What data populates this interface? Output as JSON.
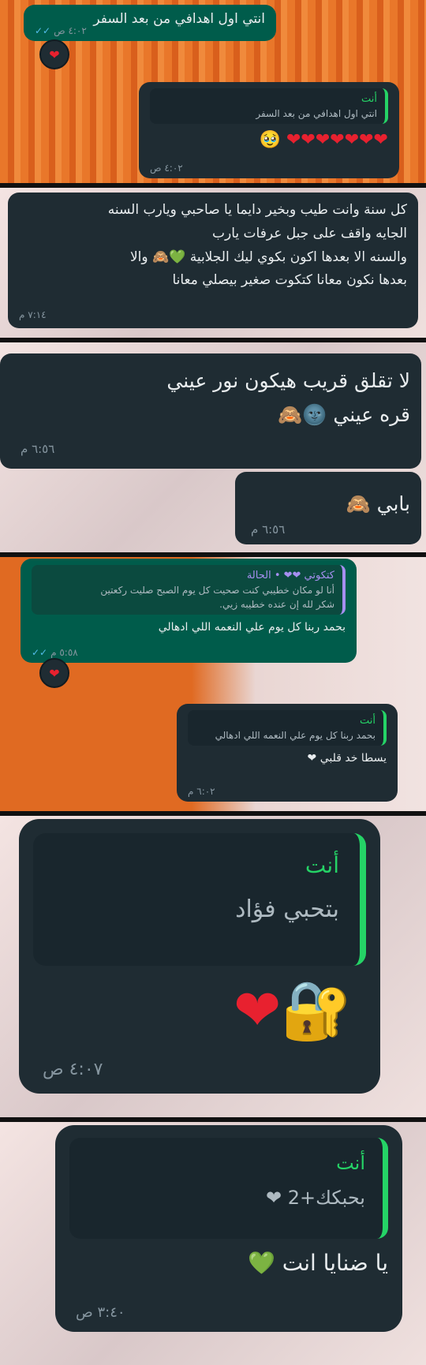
{
  "p1": {
    "msg1": {
      "text": "انتي اول اهدافي من بعد السفر",
      "time": "٤:٠٢ ص",
      "reaction": "❤"
    },
    "msg2": {
      "quote_author": "أنت",
      "quote_text": "انتي اول اهدافي من بعد السفر",
      "hearts": "❤❤❤❤❤❤❤",
      "face": "🥹",
      "time": "٤:٠٢ ص"
    }
  },
  "p2": {
    "lines": [
      "كل سنة وانت طيب وبخير دايما يا صاحبي ويارب السنه",
      "الجايه واقف على جبل عرفات يارب",
      "والسنه الا بعدها اكون بكوي ليك الجلابية 💚🙈 والا",
      "بعدها نكون معانا كتكوت  صغير بيصلي معانا"
    ],
    "time": "٧:١٤ م"
  },
  "p3": {
    "msg1": {
      "line1": "لا تقلق قريب هيكون نور عيني",
      "line2": "قره عيني 🌚🙈",
      "time": "٦:٥٦ م"
    },
    "msg2": {
      "text": "بابي 🙈",
      "time": "٦:٥٦ م"
    }
  },
  "p4": {
    "msg1": {
      "quote_author": "كتكوتي ❤❤ • الحالة",
      "quote_line1": "أنا لو مكان خطيبي كنت صحيت كل يوم الصبح صليت ركعتين",
      "quote_line2": "شكر لله إن عنده خطيبه زيي.",
      "text": "بحمد ربنا كل يوم علي النعمه اللي ادهالي",
      "time": "٥:٥٨ م",
      "reaction": "❤"
    },
    "msg2": {
      "quote_author": "أنت",
      "quote_text": "بحمد ربنا كل يوم علي النعمه اللي ادهالي",
      "text": "يسطا خد قلبي ❤",
      "time": "٦:٠٢ م"
    }
  },
  "p5": {
    "quote_author": "أنت",
    "quote_text": "بتحبي فؤاد",
    "emojis": "🔐❤",
    "time": "٤:٠٧ ص"
  },
  "p6": {
    "quote_author": "أنت",
    "quote_text": "بحبكك+2 ❤",
    "text": "يا ضنايا انت 💚",
    "time": "٣:٤٠ ص"
  }
}
